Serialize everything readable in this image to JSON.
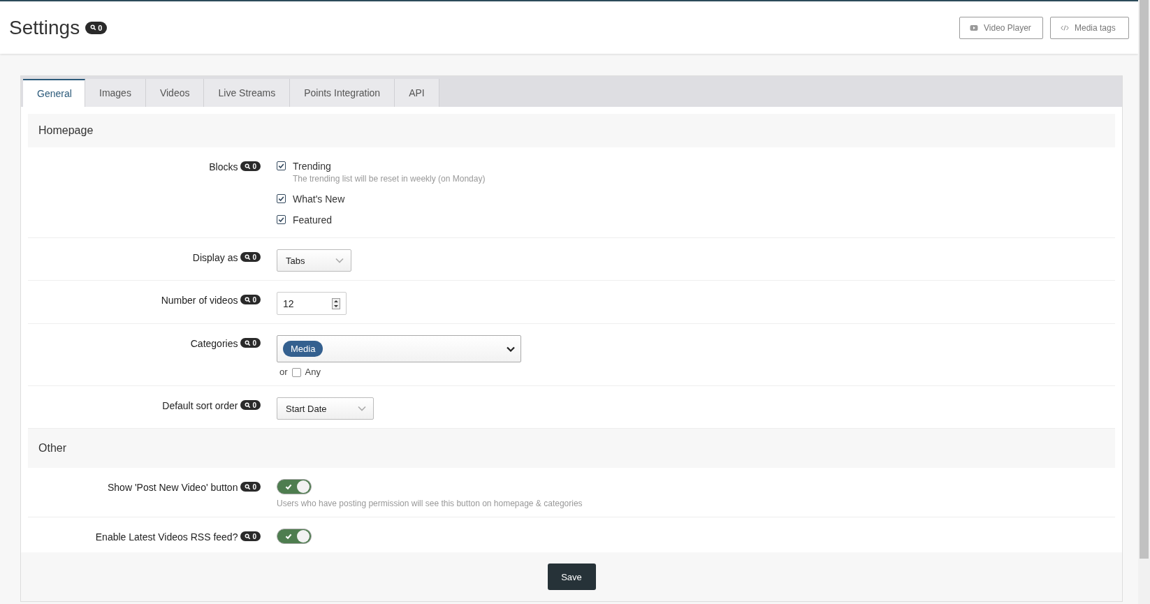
{
  "header": {
    "title": "Settings",
    "badge": "0",
    "buttons": [
      {
        "label": "Video Player",
        "kind": "video"
      },
      {
        "label": "Media tags",
        "kind": "code"
      }
    ]
  },
  "tabs": [
    {
      "label": "General",
      "selected": true
    },
    {
      "label": "Images",
      "selected": false
    },
    {
      "label": "Videos",
      "selected": false
    },
    {
      "label": "Live Streams",
      "selected": false
    },
    {
      "label": "Points Integration",
      "selected": false
    },
    {
      "label": "API",
      "selected": false
    }
  ],
  "sections": [
    {
      "title": "Homepage",
      "fields": [
        {
          "label": "Blocks",
          "badge": "0",
          "kind": "checkboxes",
          "options": [
            {
              "label": "Trending",
              "checked": true,
              "help": "The trending list will be reset in weekly (on Monday)"
            },
            {
              "label": "What's New",
              "checked": true
            },
            {
              "label": "Featured",
              "checked": true
            }
          ]
        },
        {
          "label": "Display as",
          "badge": "0",
          "kind": "select",
          "value": "Tabs"
        },
        {
          "label": "Number of videos",
          "badge": "0",
          "kind": "number",
          "value": "12"
        },
        {
          "label": "Categories",
          "badge": "0",
          "kind": "tags",
          "tags": [
            "Media"
          ],
          "any": {
            "prefix": "or",
            "label": "Any",
            "checked": false
          }
        },
        {
          "label": "Default sort order",
          "badge": "0",
          "kind": "select",
          "value": "Start Date"
        }
      ]
    },
    {
      "title": "Other",
      "fields": [
        {
          "label": "Show 'Post New Video' button",
          "badge": "0",
          "kind": "toggle",
          "on": true,
          "help": "Users who have posting permission will see this button on homepage & categories"
        },
        {
          "label": "Enable Latest Videos RSS feed?",
          "badge": "0",
          "kind": "toggle",
          "on": true
        }
      ]
    }
  ],
  "save": "Save"
}
